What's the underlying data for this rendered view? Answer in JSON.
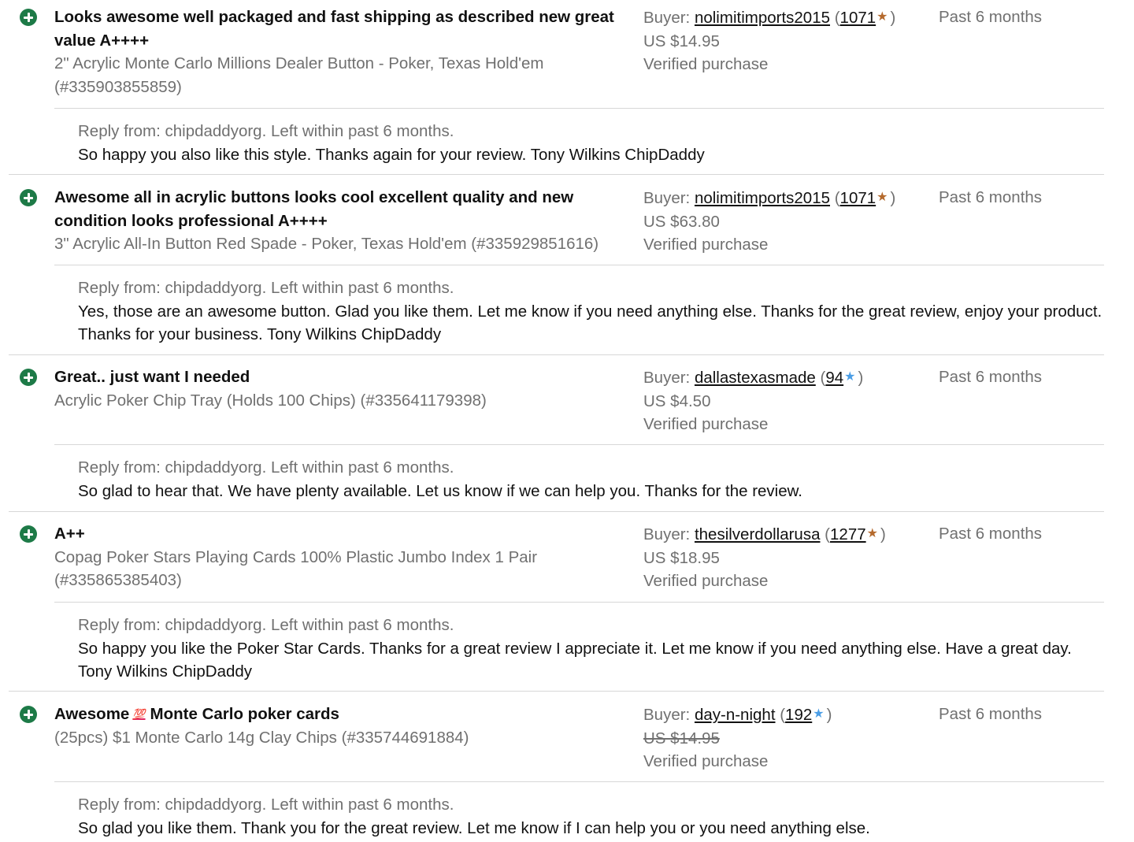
{
  "feedback": [
    {
      "comment": "Looks awesome well packaged and fast shipping as described new great value A++++",
      "item": "2\" Acrylic Monte Carlo Millions Dealer Button - Poker, Texas Hold'em (#335903855859)",
      "buyer_label": "Buyer:",
      "buyer": "nolimitimports2015",
      "score": "1071",
      "star_color": "#b56a2d",
      "price": "US $14.95",
      "verified": "Verified purchase",
      "when": "Past 6 months",
      "reply_header": "Reply from: chipdaddyorg. Left within past 6 months.",
      "reply_text": "So happy you also like this style. Thanks again for your review. Tony Wilkins ChipDaddy"
    },
    {
      "comment": "Awesome all in acrylic buttons looks cool excellent quality and new condition looks professional A++++",
      "item": "3\" Acrylic All-In Button Red Spade - Poker, Texas Hold'em (#335929851616)",
      "buyer_label": "Buyer:",
      "buyer": "nolimitimports2015",
      "score": "1071",
      "star_color": "#b56a2d",
      "price": "US $63.80",
      "verified": "Verified purchase",
      "when": "Past 6 months",
      "reply_header": "Reply from: chipdaddyorg. Left within past 6 months.",
      "reply_text": "Yes, those are an awesome button. Glad you like them. Let me know if you need anything else. Thanks for the great review, enjoy your product. Thanks for your business. Tony Wilkins ChipDaddy"
    },
    {
      "comment": "Great.. just want I needed",
      "item": "Acrylic Poker Chip Tray (Holds 100 Chips) (#335641179398)",
      "buyer_label": "Buyer:",
      "buyer": "dallastexasmade",
      "score": "94",
      "star_color": "#4b9ee6",
      "price": "US $4.50",
      "verified": "Verified purchase",
      "when": "Past 6 months",
      "reply_header": "Reply from: chipdaddyorg. Left within past 6 months.",
      "reply_text": "So glad to hear that. We have plenty available. Let us know if we can help you. Thanks for the review."
    },
    {
      "comment": "A++",
      "item": "Copag Poker Stars Playing Cards 100% Plastic Jumbo Index 1 Pair (#335865385403)",
      "buyer_label": "Buyer:",
      "buyer": "thesilverdollarusa",
      "score": "1277",
      "star_color": "#b56a2d",
      "price": "US $18.95",
      "verified": "Verified purchase",
      "when": "Past 6 months",
      "reply_header": "Reply from: chipdaddyorg. Left within past 6 months.",
      "reply_text": "So happy you like the Poker Star Cards. Thanks for a great review I appreciate it. Let me know if you need anything else. Have a great day. Tony Wilkins ChipDaddy"
    },
    {
      "comment_before": "Awesome",
      "comment_emoji": "💯",
      "comment_after": "Monte Carlo poker cards",
      "item": "(25pcs) $1 Monte Carlo 14g Clay Chips (#335744691884)",
      "buyer_label": "Buyer:",
      "buyer": "day-n-night",
      "score": "192",
      "star_color": "#4b9ee6",
      "price": "US $14.95",
      "price_struck": true,
      "verified": "Verified purchase",
      "when": "Past 6 months",
      "reply_header": "Reply from: chipdaddyorg. Left within past 6 months.",
      "reply_text": "So glad you like them. Thank you for the great review. Let me know if I can help you or you need anything else."
    }
  ]
}
